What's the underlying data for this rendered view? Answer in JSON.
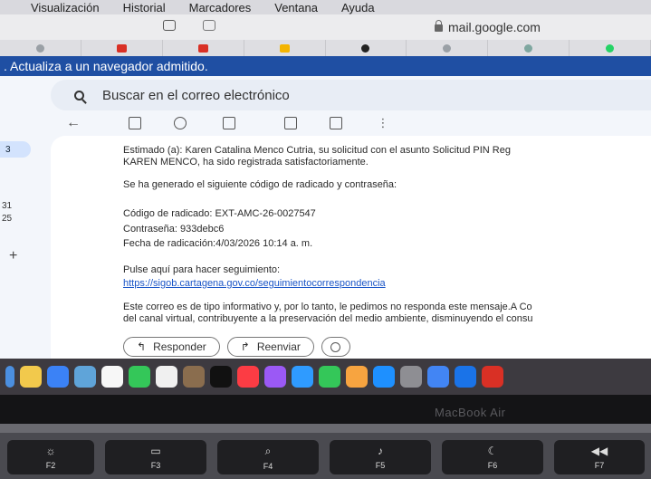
{
  "menubar": {
    "items": [
      "Visualización",
      "Historial",
      "Marcadores",
      "Ventana",
      "Ayuda"
    ]
  },
  "browser": {
    "url": "mail.google.com",
    "tab_icons": [
      "chrome-icon",
      "gmail-icon",
      "gmail-icon",
      "drive-icon",
      "pinterest-icon",
      "chrome-icon",
      "copilot-icon",
      "whatsapp-icon"
    ]
  },
  "banner": {
    "text": ". Actualiza a un navegador admitido."
  },
  "gmail": {
    "search_placeholder": "Buscar en el correo electrónico",
    "rail": {
      "count_top": "3",
      "count_a": "31",
      "count_b": "25"
    },
    "message": {
      "line1": "Estimado (a): Karen Catalina Menco Cutria, su solicitud con el asunto Solicitud PIN Reg",
      "line2": "KAREN MENCO, ha sido registrada satisfactoriamente.",
      "line3": "Se ha generado el siguiente código de radicado y contraseña:",
      "codigo": "Código de radicado: EXT-AMC-26-0027547",
      "contrasena": "Contraseña: 933debc6",
      "fecha": "Fecha de radicación:4/03/2026 10:14 a. m.",
      "pulse": "Pulse aquí para hacer seguimiento:",
      "link": "https://sigob.cartagena.gov.co/seguimientocorrespondencia",
      "info1": "Este correo es de tipo informativo y, por lo tanto, le pedimos no responda este mensaje.A Co",
      "info2": "del canal virtual, contribuyente a la preservación del medio ambiente, disminuyendo el consu"
    },
    "reply_label": "Responder",
    "forward_label": "Reenviar"
  },
  "laptop": {
    "brand": "MacBook Air",
    "keys": [
      {
        "icon": "brightness-icon",
        "label": "F2"
      },
      {
        "icon": "mission-control-icon",
        "label": "F3"
      },
      {
        "icon": "search-icon",
        "label": "F4"
      },
      {
        "icon": "microphone-icon",
        "label": "F5"
      },
      {
        "icon": "moon-icon",
        "label": "F6"
      },
      {
        "icon": "rewind-icon",
        "label": "F7"
      }
    ]
  },
  "colors": {
    "banner": "#1f4fa3",
    "link": "#1a55c7",
    "search_bg": "#e8edf5"
  }
}
